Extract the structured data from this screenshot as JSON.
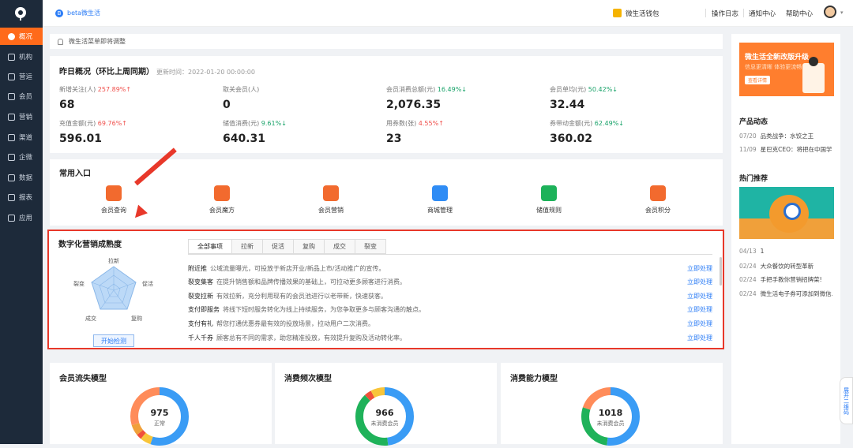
{
  "brand": {
    "name": "beta微生活"
  },
  "topnav": {
    "wallet": "微生活钱包",
    "log": "操作日志",
    "notify": "通知中心",
    "help": "帮助中心"
  },
  "sidebar": [
    {
      "label": "概况",
      "icon": "overview-icon",
      "active": true
    },
    {
      "label": "机构",
      "icon": "organization-icon"
    },
    {
      "label": "营运",
      "icon": "operation-icon"
    },
    {
      "label": "会员",
      "icon": "member-icon"
    },
    {
      "label": "营销",
      "icon": "marketing-icon"
    },
    {
      "label": "渠道",
      "icon": "channel-icon"
    },
    {
      "label": "企微",
      "icon": "wecom-icon"
    },
    {
      "label": "数据",
      "icon": "data-icon"
    },
    {
      "label": "报表",
      "icon": "report-icon"
    },
    {
      "label": "应用",
      "icon": "apps-icon"
    }
  ],
  "notice": "微生活菜单即将调整",
  "overview": {
    "title": "昨日概况（环比上周同期）",
    "updated": "更新时间：2022-01-20 00:00:00",
    "stats": [
      {
        "label": "新增关注(人)",
        "change": "257.89%↑",
        "dir": "up",
        "value": "68"
      },
      {
        "label": "取关会员(人)",
        "change": "",
        "dir": "",
        "value": "0"
      },
      {
        "label": "会员消费总额(元)",
        "change": "16.49%↓",
        "dir": "down",
        "value": "2,076.35"
      },
      {
        "label": "会员单均(元)",
        "change": "50.42%↓",
        "dir": "down",
        "value": "32.44"
      },
      {
        "label": "充值金额(元)",
        "change": "69.76%↑",
        "dir": "up",
        "value": "596.01"
      },
      {
        "label": "储值消费(元)",
        "change": "9.61%↓",
        "dir": "down",
        "value": "640.31"
      },
      {
        "label": "用券数(张)",
        "change": "4.55%↑",
        "dir": "up",
        "value": "23"
      },
      {
        "label": "券带动金额(元)",
        "change": "62.49%↓",
        "dir": "down",
        "value": "360.02"
      }
    ]
  },
  "entries": {
    "title": "常用入口",
    "items": [
      {
        "label": "会员查询",
        "color": "#f26a2e",
        "icon": "member-search-icon"
      },
      {
        "label": "会员魔方",
        "color": "#f26a2e",
        "icon": "member-cube-icon"
      },
      {
        "label": "会员营销",
        "color": "#f26a2e",
        "icon": "member-marketing-icon"
      },
      {
        "label": "商城管理",
        "color": "#2f8cf5",
        "icon": "mall-icon"
      },
      {
        "label": "储值规则",
        "color": "#1db25a",
        "icon": "stored-value-icon"
      },
      {
        "label": "会员积分",
        "color": "#f26a2e",
        "icon": "points-icon"
      }
    ]
  },
  "maturity": {
    "title": "数字化营销成熟度",
    "radar_labels": [
      "拉新",
      "促活",
      "复购",
      "成交",
      "裂变"
    ],
    "detect_button": "开始检测",
    "tabs": [
      "全部事项",
      "拉新",
      "促活",
      "复购",
      "成交",
      "裂变"
    ],
    "tasks": [
      {
        "name": "附近推",
        "desc": "公域流量曝光，可投放于新店开业/新品上市/活动推广的宣传。",
        "action": "立即处理"
      },
      {
        "name": "裂变集客",
        "desc": "在提升销售额和品牌传播效果的基础上，可拉动更多顾客进行消费。",
        "action": "立即处理"
      },
      {
        "name": "裂变拉新",
        "desc": "有效拉新，充分利用现有的会员池进行以老带新，快速获客。",
        "action": "立即处理"
      },
      {
        "name": "支付即服务",
        "desc": "将线下短时服务转化为线上持续服务，为您争取更多与顾客沟通的触点。",
        "action": "立即处理"
      },
      {
        "name": "支付有礼",
        "desc": "帮您打通优惠券最有效的投放场景，拉动用户二次消费。",
        "action": "立即处理"
      },
      {
        "name": "千人千券",
        "desc": "顾客总有不同的需求，助您精准投放，有效提升复购及活动转化率。",
        "action": "立即处理"
      }
    ]
  },
  "models": [
    {
      "title": "会员流失模型",
      "value": "975",
      "sub": "正常"
    },
    {
      "title": "消费频次模型",
      "value": "966",
      "sub": "未消费会员"
    },
    {
      "title": "消费能力模型",
      "value": "1018",
      "sub": "未消费会员"
    }
  ],
  "right": {
    "banner_title": "微生活全新改版升级",
    "banner_sub": "信息更清晰 体验更流畅",
    "banner_btn": "查看详情",
    "product_title": "产品动态",
    "product_items": [
      {
        "date": "07/20",
        "text": "品类战争：水饺之王"
      },
      {
        "date": "11/09",
        "text": "星巴克CEO：将把在中国学..."
      }
    ],
    "hot_title": "热门推荐",
    "hot_items": [
      {
        "date": "04/13",
        "text": "1"
      },
      {
        "date": "02/24",
        "text": "大众餐饮的转型革新"
      },
      {
        "date": "02/24",
        "text": "手把手教你营销招牌菜!"
      },
      {
        "date": "02/24",
        "text": "微生活电子券可添加到微信..."
      }
    ]
  },
  "float_tab": "展开二维码"
}
